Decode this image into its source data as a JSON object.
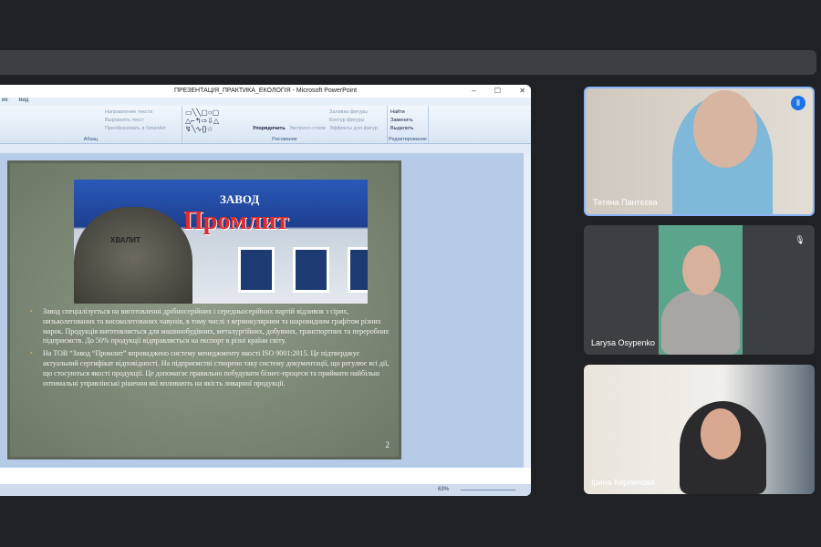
{
  "window": {
    "title": "ПРЕЗЕНТАЦІЯ_ПРАКТИКА_ЕКОЛОГІЯ - Microsoft PowerPoint",
    "minimize": "–",
    "maximize": "☐",
    "close": "✕"
  },
  "menu": [
    "ие",
    "Вид"
  ],
  "ribbon": {
    "paragraph": {
      "label": "Абзац",
      "items": [
        "Направление текста",
        "Выровнять текст",
        "Преобразовать в SmartArt"
      ]
    },
    "drawing": {
      "label": "Рисование",
      "arrange": "Упорядочить",
      "quick_styles": "Экспресс-стили",
      "items": [
        "Заливка фигуры",
        "Контур фигуры",
        "Эффекты для фигур"
      ]
    },
    "editing": {
      "label": "Редактирование",
      "items": [
        "Найти",
        "Заменить",
        "Выделить"
      ]
    }
  },
  "slide": {
    "brand_top": "ЗАВОД",
    "brand": "Промлит",
    "bell_text": "ХВАЛИТ",
    "bullets": [
      "Завод спеціалізується на виготовленні дрібносерійних і середньосерійних партій відливок з сірих, низьколегованих та високолегованих чавунів, в тому числі з вермикулярним та шаровидним графітом різних марок. Продукція виготовляється для машинобудівних, металургійних, добувних, транспортних та переробних підприємств. До 50% продукції відправляється на експорт в різні країни світу.",
      "На ТОВ “Завод “Промлит” впроваджено систему менеджменту якості ISO 9001:2015. Це підтверджує актуальний сертифікат відповідності. На підприємстві створено таку систему документації, що регулює всі дії, що стосуються якості продукції. Це допомагає правильно побудувати бізнес-процеси та приймати найбільш оптимальні управлінські рішення які впливають на якість ливарної продукції."
    ],
    "page_number": "2"
  },
  "status": {
    "zoom": "63%"
  },
  "participants": [
    {
      "name": "Тетяна Пантєєва",
      "speaking": true
    },
    {
      "name": "Larysa Osypenko",
      "muted": true
    },
    {
      "name": "Ірина Кирпичова"
    }
  ]
}
